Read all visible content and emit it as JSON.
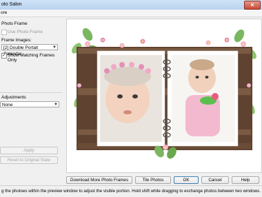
{
  "window": {
    "title": "oto Salon"
  },
  "menubar": {
    "menu_label": "ore"
  },
  "photo_frame": {
    "section_label": "Photo Frame",
    "use_photo_frame_label": "Use Photo Frame",
    "frame_images_label": "Frame Images:",
    "frame_images_value": "[2] Double Portait Calendar",
    "show_matching_label": "Show Matching Frames Only"
  },
  "adjustments": {
    "section_label": "Adjustments",
    "value": "None",
    "apply_label": "Apply",
    "reset_label": "Reset to Original State"
  },
  "buttons": {
    "download": "Download More Photo Frames",
    "tile": "Tile Photos",
    "ok": "OK",
    "cancel": "Cancel",
    "help": "Help"
  },
  "status": {
    "message": "g the photoes within the preview window to adjust the visible portion. Hold shift while dragging to exchange photos between two windows."
  },
  "colors": {
    "frame_wood": "#5f4330",
    "calendar_page": "#ffffff",
    "flower_pink": "#e58fb8",
    "leaf_green": "#6aa84f"
  },
  "icons": {
    "close": "close-icon",
    "dropdown": "chevron-down-icon",
    "check": "checkmark-icon"
  }
}
